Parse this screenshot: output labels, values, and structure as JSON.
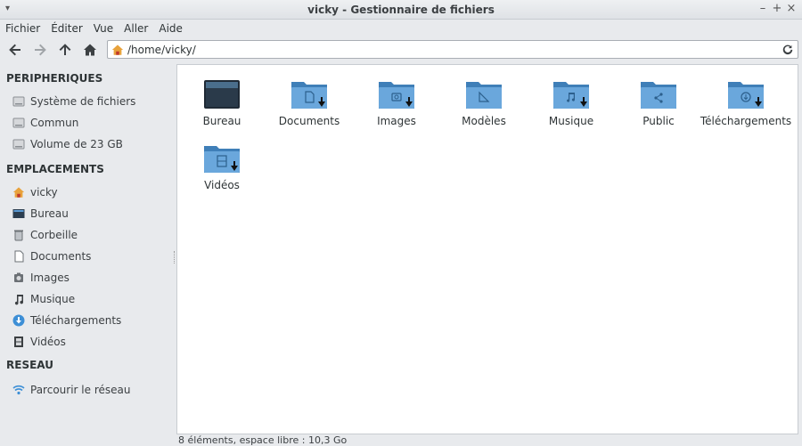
{
  "window": {
    "title": "vicky - Gestionnaire de fichiers"
  },
  "menubar": [
    "Fichier",
    "Éditer",
    "Vue",
    "Aller",
    "Aide"
  ],
  "location": {
    "path": "/home/vicky/"
  },
  "sidebar": {
    "devices_header": "PERIPHERIQUES",
    "devices": [
      {
        "label": "Système de fichiers",
        "icon": "drive-icon"
      },
      {
        "label": "Commun",
        "icon": "drive-icon"
      },
      {
        "label": "Volume de 23 GB",
        "icon": "drive-icon"
      }
    ],
    "places_header": "EMPLACEMENTS",
    "places": [
      {
        "label": "vicky",
        "icon": "home-icon"
      },
      {
        "label": "Bureau",
        "icon": "desktop-icon"
      },
      {
        "label": "Corbeille",
        "icon": "trash-icon"
      },
      {
        "label": "Documents",
        "icon": "document-icon"
      },
      {
        "label": "Images",
        "icon": "image-icon"
      },
      {
        "label": "Musique",
        "icon": "music-icon"
      },
      {
        "label": "Téléchargements",
        "icon": "download-icon"
      },
      {
        "label": "Vidéos",
        "icon": "video-icon"
      }
    ],
    "network_header": "RESEAU",
    "network": [
      {
        "label": "Parcourir le réseau",
        "icon": "network-icon"
      }
    ]
  },
  "files": [
    {
      "label": "Bureau",
      "icon": "desktop-folder-icon"
    },
    {
      "label": "Documents",
      "icon": "documents-folder-icon"
    },
    {
      "label": "Images",
      "icon": "pictures-folder-icon"
    },
    {
      "label": "Modèles",
      "icon": "templates-folder-icon"
    },
    {
      "label": "Musique",
      "icon": "music-folder-icon"
    },
    {
      "label": "Public",
      "icon": "public-folder-icon"
    },
    {
      "label": "Téléchargements",
      "icon": "downloads-folder-icon"
    },
    {
      "label": "Vidéos",
      "icon": "videos-folder-icon"
    }
  ],
  "status": {
    "text": "8 éléments, espace libre : 10,3 Go"
  },
  "colors": {
    "folder": "#5b9bd5",
    "folder_dark": "#3f7fb8",
    "sidebar_bg": "#e8eaed",
    "accent": "#2e3436"
  }
}
